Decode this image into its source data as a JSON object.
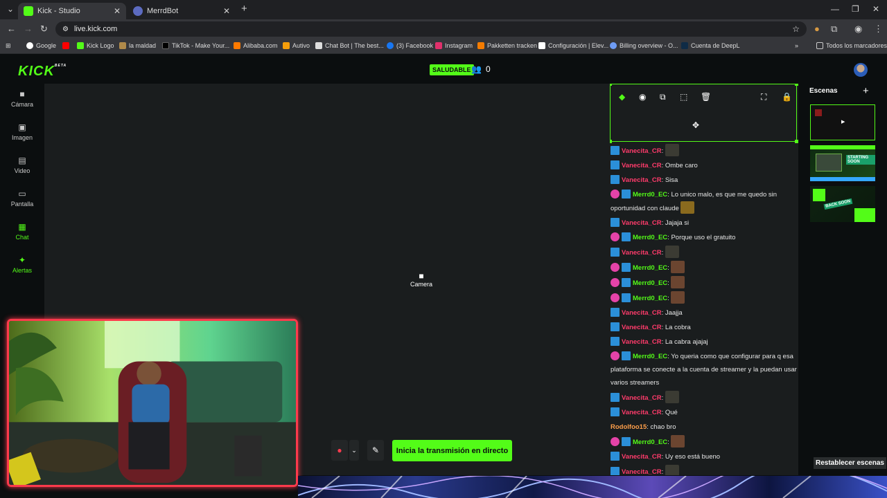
{
  "browser": {
    "tabs": [
      {
        "label": "Kick - Studio",
        "active": true
      },
      {
        "label": "MerrdBot",
        "active": false
      }
    ],
    "url": "live.kick.com",
    "bookmarks": [
      "Google",
      "Kick Logo",
      "la maldad",
      "TikTok - Make Your...",
      "Alibaba.com",
      "Autivo",
      "Chat Bot | The best...",
      "(3) Facebook",
      "Instagram",
      "Pakketten tracken",
      "Configuración | Elev...",
      "Billing overview - O...",
      "Cuenta de DeepL"
    ],
    "all_bookmarks": "Todos los marcadores"
  },
  "header": {
    "logo": "KICK",
    "logo_sup": "BETA",
    "status": "SALUDABLE",
    "viewer_count": "0"
  },
  "leftnav": [
    {
      "label": "Cámara",
      "icon": "camera-icon",
      "active": false
    },
    {
      "label": "Imagen",
      "icon": "image-icon",
      "active": false
    },
    {
      "label": "Video",
      "icon": "film-icon",
      "active": false
    },
    {
      "label": "Pantalla",
      "icon": "screen-icon",
      "active": false
    },
    {
      "label": "Chat",
      "icon": "chat-icon",
      "active": true
    },
    {
      "label": "Alertas",
      "icon": "alert-icon",
      "active": true
    }
  ],
  "canvas": {
    "camera_label": "Camera"
  },
  "chat_messages": [
    {
      "badges": [
        "blue"
      ],
      "user": "Vanecita_CR",
      "color": "red",
      "text": "",
      "emote": "dark"
    },
    {
      "badges": [
        "blue"
      ],
      "user": "Vanecita_CR",
      "color": "red",
      "text": "Ombe caro"
    },
    {
      "badges": [
        "blue"
      ],
      "user": "Vanecita_CR",
      "color": "red",
      "text": "Sisa"
    },
    {
      "badges": [
        "pink",
        "blue"
      ],
      "user": "Merrd0_EC",
      "color": "green",
      "text": "Lo unico malo, es que me quedo sin oportunidad con claude",
      "emote": "gold"
    },
    {
      "badges": [
        "blue"
      ],
      "user": "Vanecita_CR",
      "color": "red",
      "text": "Jajaja si"
    },
    {
      "badges": [
        "pink",
        "blue"
      ],
      "user": "Merrd0_EC",
      "color": "green",
      "text": "Porque uso el gratuito"
    },
    {
      "badges": [
        "blue"
      ],
      "user": "Vanecita_CR",
      "color": "red",
      "text": "",
      "emote": "dark"
    },
    {
      "badges": [
        "pink",
        "blue"
      ],
      "user": "Merrd0_EC",
      "color": "green",
      "text": "",
      "emote": "face"
    },
    {
      "badges": [
        "pink",
        "blue"
      ],
      "user": "Merrd0_EC",
      "color": "green",
      "text": "",
      "emote": "face"
    },
    {
      "badges": [
        "pink",
        "blue"
      ],
      "user": "Merrd0_EC",
      "color": "green",
      "text": "",
      "emote": "face"
    },
    {
      "badges": [
        "blue"
      ],
      "user": "Vanecita_CR",
      "color": "red",
      "text": "Jaajja"
    },
    {
      "badges": [
        "blue"
      ],
      "user": "Vanecita_CR",
      "color": "red",
      "text": "La cobra"
    },
    {
      "badges": [
        "blue"
      ],
      "user": "Vanecita_CR",
      "color": "red",
      "text": "La cabra ajajaj"
    },
    {
      "badges": [
        "pink",
        "blue"
      ],
      "user": "Merrd0_EC",
      "color": "green",
      "text": "Yo queria como que configurar para q esa plataforma se conecte a la cuenta de streamer y la puedan usar varios streamers"
    },
    {
      "badges": [
        "blue"
      ],
      "user": "Vanecita_CR",
      "color": "red",
      "text": "",
      "emote": "dark"
    },
    {
      "badges": [
        "blue"
      ],
      "user": "Vanecita_CR",
      "color": "red",
      "text": "Qué"
    },
    {
      "badges": [],
      "user": "Rodolfoo15",
      "color": "orange",
      "text": "chao bro"
    },
    {
      "badges": [
        "pink",
        "blue"
      ],
      "user": "Merrd0_EC",
      "color": "green",
      "text": "",
      "emote": "face"
    },
    {
      "badges": [
        "blue"
      ],
      "user": "Vanecita_CR",
      "color": "red",
      "text": "Uy eso está bueno"
    },
    {
      "badges": [
        "blue"
      ],
      "user": "Vanecita_CR",
      "color": "red",
      "text": "",
      "emote": "dark"
    }
  ],
  "scenes": {
    "title": "Escenas",
    "thumbs": [
      "scene-1",
      "scene-starting-soon",
      "scene-back-soon"
    ],
    "thumb_text": [
      "STARTING SOON",
      "BACK SOON"
    ],
    "reset_label": "Restablecer escenas"
  },
  "controls": {
    "go_live": "Inicia la transmisión en directo"
  },
  "colors": {
    "kick_green": "#53fc18",
    "red_user": "#ff3b6b",
    "orange_user": "#ff9f4a",
    "badge_pink": "#e443a8",
    "badge_blue": "#2b8fd8"
  }
}
